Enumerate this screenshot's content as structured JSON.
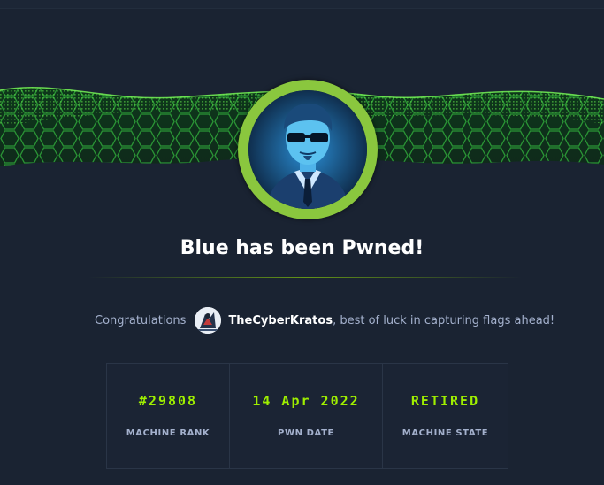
{
  "machine": {
    "title": "Blue has been Pwned!"
  },
  "congrats": {
    "prefix": "Congratulations",
    "username": "TheCyberKratos",
    "suffix": ", best of luck in capturing flags ahead!"
  },
  "stats": [
    {
      "value": "#29808",
      "label": "MACHINE RANK"
    },
    {
      "value": "14 Apr 2022",
      "label": "PWN DATE"
    },
    {
      "value": "RETIRED",
      "label": "MACHINE STATE"
    }
  ],
  "colors": {
    "background": "#1a2332",
    "accent": "#9fef00",
    "ring": "#8ac73e",
    "muted_text": "#a4b1cd"
  },
  "icons": {
    "machine_avatar": "agent-avatar-icon",
    "user_avatar": "user-avatar-icon"
  }
}
